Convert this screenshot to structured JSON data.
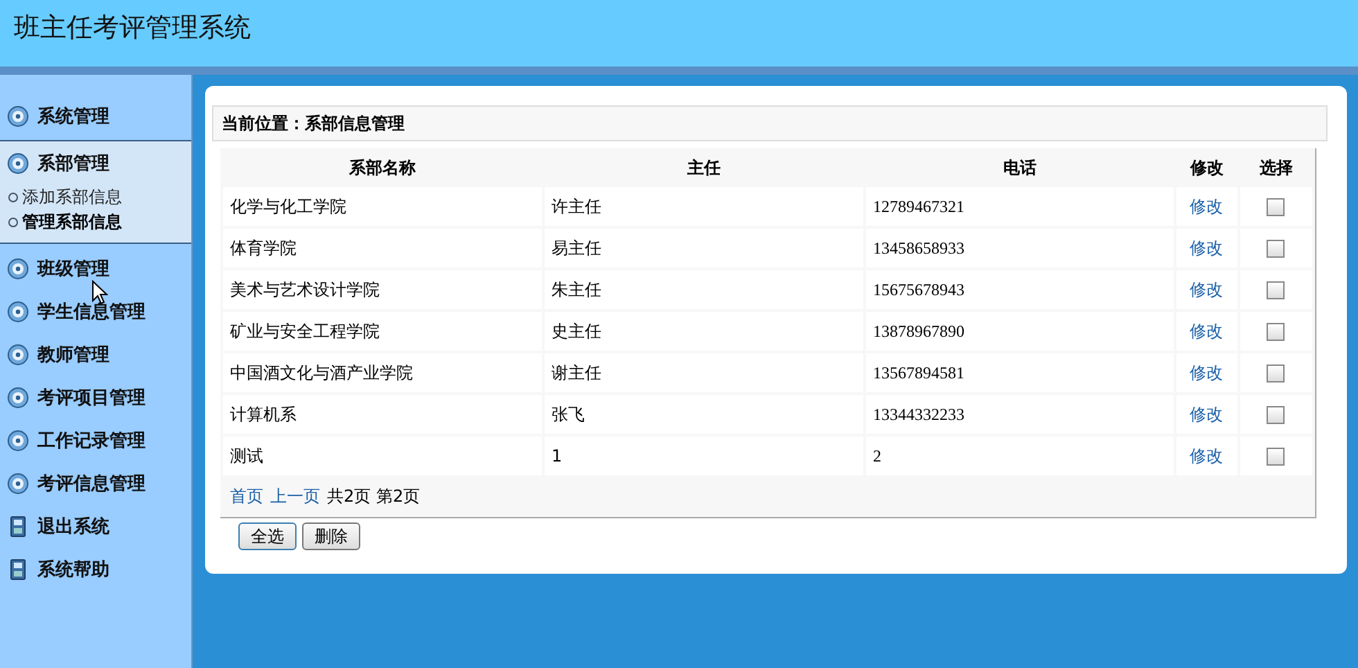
{
  "header": {
    "title": "班主任考评管理系统"
  },
  "sidebar": {
    "items": [
      {
        "label": "系统管理",
        "kind": "disc",
        "expanded": false
      },
      {
        "label": "系部管理",
        "kind": "disc",
        "expanded": true,
        "children": [
          {
            "label": "添加系部信息",
            "selected": false
          },
          {
            "label": "管理系部信息",
            "selected": true
          }
        ]
      },
      {
        "label": "班级管理",
        "kind": "disc",
        "expanded": false
      },
      {
        "label": "学生信息管理",
        "kind": "disc",
        "expanded": false
      },
      {
        "label": "教师管理",
        "kind": "disc",
        "expanded": false
      },
      {
        "label": "考评项目管理",
        "kind": "disc",
        "expanded": false
      },
      {
        "label": "工作记录管理",
        "kind": "disc",
        "expanded": false
      },
      {
        "label": "考评信息管理",
        "kind": "disc",
        "expanded": false
      },
      {
        "label": "退出系统",
        "kind": "phone",
        "expanded": false
      },
      {
        "label": "系统帮助",
        "kind": "phone",
        "expanded": false
      }
    ]
  },
  "breadcrumb": "当前位置：系部信息管理",
  "table": {
    "columns": [
      "系部名称",
      "主任",
      "电话",
      "修改",
      "选择"
    ],
    "rows": [
      {
        "name": "化学与化工学院",
        "head": "许主任",
        "phone": "12789467321",
        "edit": "修改",
        "checked": false
      },
      {
        "name": "体育学院",
        "head": "易主任",
        "phone": "13458658933",
        "edit": "修改",
        "checked": false
      },
      {
        "name": "美术与艺术设计学院",
        "head": "朱主任",
        "phone": "15675678943",
        "edit": "修改",
        "checked": false
      },
      {
        "name": "矿业与安全工程学院",
        "head": "史主任",
        "phone": "13878967890",
        "edit": "修改",
        "checked": false
      },
      {
        "name": "中国酒文化与酒产业学院",
        "head": "谢主任",
        "phone": "13567894581",
        "edit": "修改",
        "checked": false
      },
      {
        "name": "计算机系",
        "head": "张飞",
        "phone": "13344332233",
        "edit": "修改",
        "checked": false
      },
      {
        "name": "测试",
        "head": "1",
        "phone": "2",
        "edit": "修改",
        "checked": false
      }
    ]
  },
  "pager": {
    "links": [
      "首页",
      "上一页"
    ],
    "info": "共2页 第2页"
  },
  "buttons": [
    "全选",
    "删除"
  ]
}
